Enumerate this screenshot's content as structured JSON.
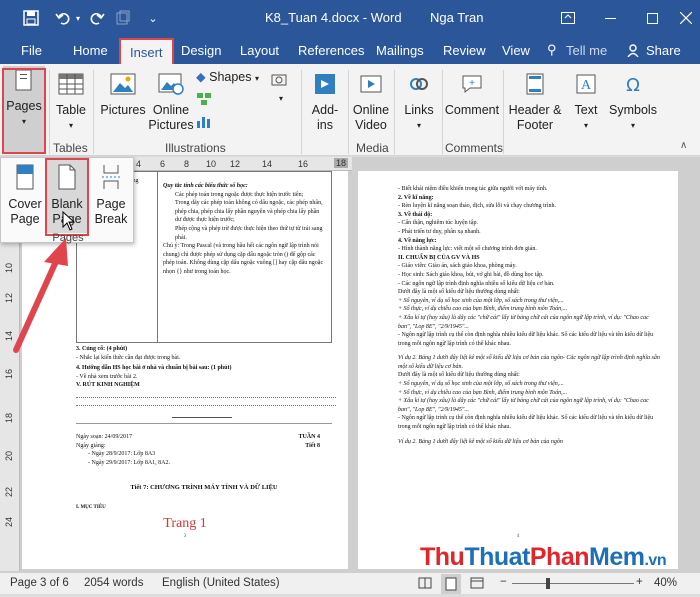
{
  "titlebar": {
    "title": "K8_Tuan 4.docx - Word",
    "user": "Nga Tran",
    "bg": "#2b579a"
  },
  "menu": {
    "file": "File",
    "home": "Home",
    "insert": "Insert",
    "design": "Design",
    "layout": "Layout",
    "references": "References",
    "mailings": "Mailings",
    "review": "Review",
    "view": "View",
    "tellme": "Tell me",
    "share": "Share"
  },
  "ribbon": {
    "pages": "Pages",
    "table": "Table",
    "pictures": "Pictures",
    "online_pictures": [
      "Online",
      "Pictures"
    ],
    "shapes": "Shapes",
    "addins": [
      "Add-",
      "ins"
    ],
    "online_video": [
      "Online",
      "Video"
    ],
    "links": "Links",
    "comment": "Comment",
    "header_footer": [
      "Header &",
      "Footer"
    ],
    "text": "Text",
    "symbols": "Symbols",
    "groups": {
      "tables": "Tables",
      "illustrations": "Illustrations",
      "media": "Media",
      "comments": "Comments"
    }
  },
  "dropdown": {
    "cover": [
      "Cover",
      "Page"
    ],
    "blank": [
      "Blank",
      "Page"
    ],
    "break": [
      "Page",
      "Break"
    ],
    "label": "Pages"
  },
  "ruler": {
    "marks": [
      "4",
      "6",
      "8",
      "10",
      "12",
      "14",
      "16",
      "18"
    ],
    "vmarks": [
      "8",
      "10",
      "12",
      "14",
      "16",
      "18",
      "20",
      "22",
      "24"
    ]
  },
  "page_left": {
    "top_right": [
      "Quy tắc tính các biểu thức số học:",
      "Các phép toán trong ngoặc được thực hiện trước tiên;",
      "Trong dãy các phép toán không có dấu ngoặc, các phép nhân, phép chia, phép chia lấy phần nguyên và phép chia lấy phần dư được thực hiện trước;",
      "Phép cộng và phép trừ được thực hiện theo thứ tự từ trái sang phải.",
      "Chú ý: Trong Pascal (và trong hầu hết các ngôn ngữ lập trình nói chung) chỉ được phép sử dụng cặp dấu ngoặc tròn () để gộp các phép toán. Không dùng cặp dấu ngoặc vuông [] hay cặp dấu ngoặc nhọn {} như trong toán học."
    ],
    "top_left": [
      ", Đồ dùng học tập, bảng",
      "đưa ra chủ ý"
    ],
    "lines": [
      "3. Củng cố: (4 phút)",
      "- Nhắc lại kiến thức cần đạt được trong bài.",
      "4. Hướng dẫn HS học bài ở nhà và chuẩn bị bài sau: (1 phút)",
      "- Về nhà xem trước bài 2.",
      "V. RÚT KINH NGHIỆM"
    ],
    "p2_lines": [
      "Ngày soạn: 24/09/2017",
      "Ngày giảng:",
      "- Ngày 28/9/2017: Lớp 8A3",
      "- Ngày 29/9/2017: Lớp 8A1, 8A2."
    ],
    "tuan": "TUẦN 4",
    "tiet": "Tiết 8",
    "heading": "Tiết 7: CHƯƠNG TRÌNH MÁY TÍNH VÀ DỮ LIỆU",
    "muctieu": "I. MỤC TIÊU",
    "trang": "Trang 1",
    "pnum": "3"
  },
  "page_right": {
    "lines": [
      "- Biết khái niệm điều khiển trong tác giữa người với máy tính.",
      "2. Về kĩ năng:",
      "- Rèn luyện kĩ năng soạn thảo, dịch, sửa lỗi và chạy chương trình.",
      "3. Về thái độ:",
      "- Cẩn thận, nghiêm túc luyện tập.",
      "- Phát triển tư duy, phân xạ nhanh.",
      "4. Về năng lực:",
      "- Hình thành năng lực: viết một số chương trình đơn giản.",
      "II. CHUẨN BỊ CỦA GV VÀ HS",
      "- Giáo viên: Giáo án, sách giáo khoa, phòng máy.",
      "- Học sinh: Sách giáo khoa, bút, vở ghi bài, đồ dùng học tập.",
      "- Các ngôn ngữ lập trình định nghĩa nhiều số kiểu dữ liệu cơ bản.",
      "Dưới đây là một số kiểu dữ liệu thường dùng nhất:",
      "+ Số nguyên, ví dụ số học sinh của một lớp, số sách trong thư viện,...",
      "+ Số thực, ví dụ chiều cao của bạn Bình, điểm trung bình môn Toán,...",
      "+ Xâu kí tự (hay xâu) là dãy các \"chữ cái\" lấy từ bảng chữ cái của ngôn ngữ lập trình, ví dụ: \"Chao cac ban\", \"Lop 8E\", \"2/9/1945\"...",
      "- Ngôn ngữ lập trình cụ thể còn định nghĩa nhiều kiểu dữ liệu khác. Số các kiểu dữ liệu và tên kiểu dữ liệu trong mỗi ngôn ngữ lập trình có thể khác nhau.",
      "",
      "Ví dụ 2. Bảng 1 dưới đây liệt kê một số kiểu dữ liệu cơ bản của ngôn- Các ngôn ngữ lập trình định nghĩa sẵn một số kiểu dữ liệu cơ bản.",
      "Dưới đây là một số kiểu dữ liệu thường dùng nhất:",
      "+ Số nguyên, ví dụ số học sinh của một lớp, số sách trong thư viện,...",
      "+ Số thực, ví dụ chiều cao của bạn Bình, điểm trung bình môn Toán,...",
      "+ Xâu kí tự (hay xâu) là dãy các \"chữ cái\" lấy từ bảng chữ cái của ngôn ngữ lập trình, ví dụ: \"Chao cac ban\", \"Lop 8E\", \"2/9/1945\"...",
      "- Ngôn ngữ lập trình cụ thể còn định nghĩa nhiều kiểu dữ liệu khác. Số các kiểu dữ liệu và tên kiểu dữ liệu trong mỗi ngôn ngữ lập trình có thể khác nhau.",
      "",
      "Ví dụ 2. Bảng 1 dưới đây liệt kê một số kiểu dữ liệu cơ bản của ngôn"
    ],
    "pnum": "4"
  },
  "statusbar": {
    "page": "Page 3 of 6",
    "words": "2054 words",
    "lang": "English (United States)",
    "zoom": "40%",
    "minus": "−",
    "plus": "+"
  },
  "watermark": {
    "a": "Thu",
    "b": "Thuat",
    "c": "Phan",
    "d": "Mem",
    ".vn": ".vn",
    "colors": {
      "red": "#e0252b",
      "blue": "#1d6fb8"
    }
  }
}
